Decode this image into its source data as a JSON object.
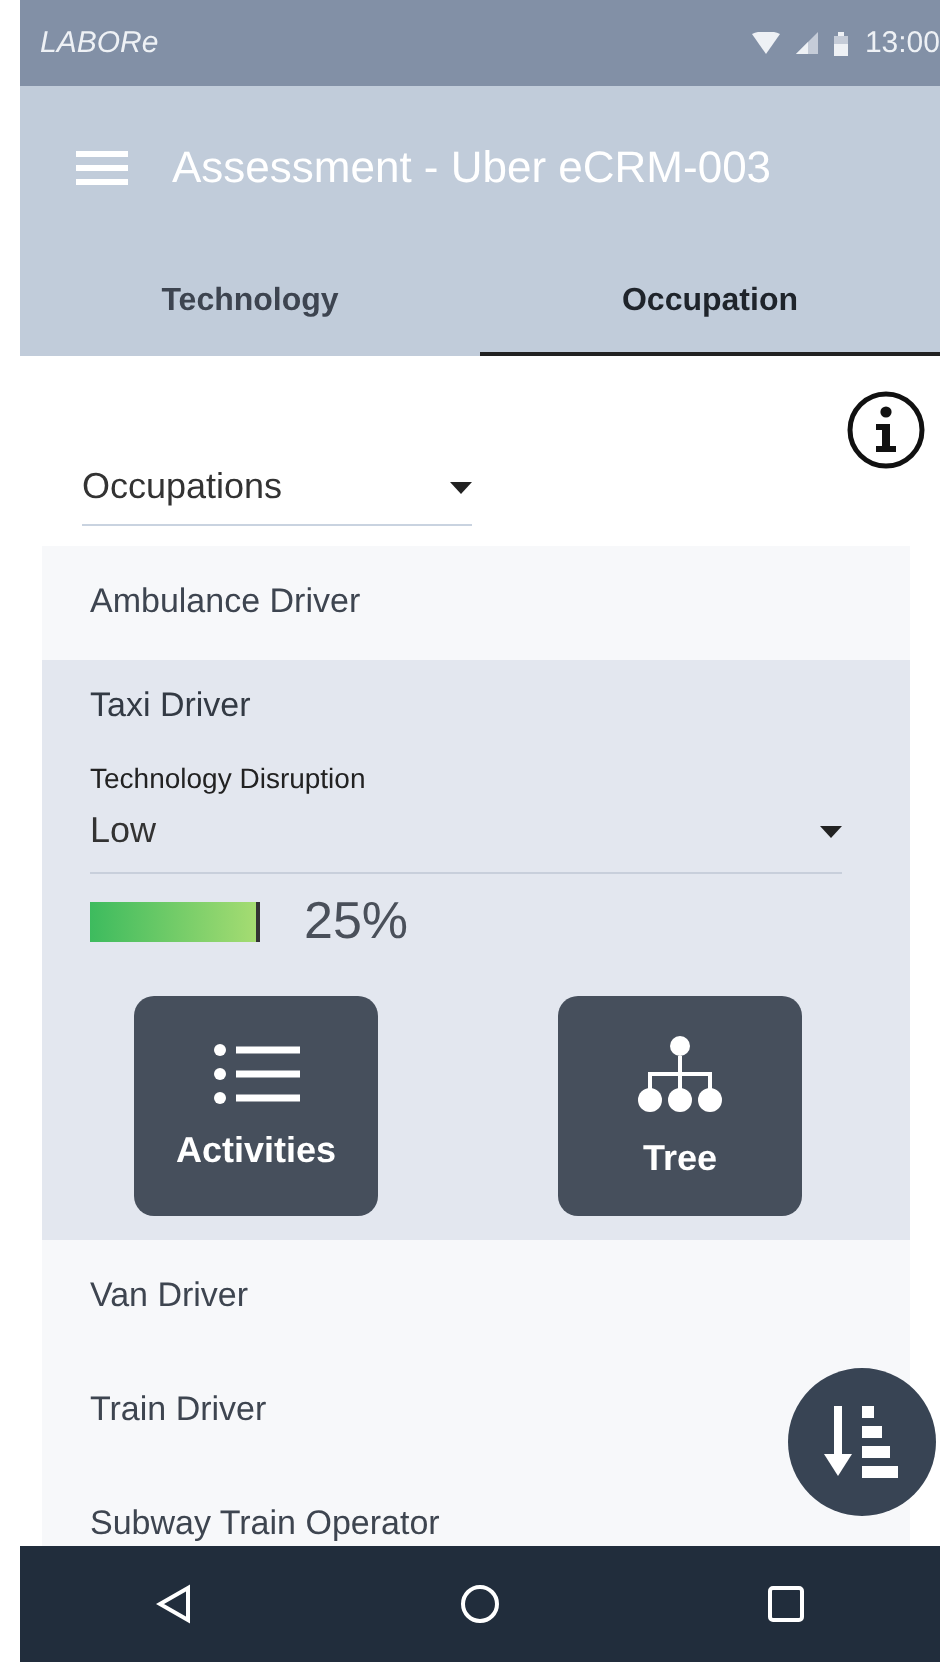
{
  "status_bar": {
    "app_name": "LABORe",
    "time": "13:00"
  },
  "app_bar": {
    "title": "Assessment - Uber eCRM-003"
  },
  "tabs": [
    {
      "label": "Technology",
      "selected": false
    },
    {
      "label": "Occupation",
      "selected": true
    }
  ],
  "filter": {
    "value": "Occupations"
  },
  "occupations": [
    {
      "name": "Ambulance Driver",
      "expanded": false
    },
    {
      "name": "Taxi Driver",
      "expanded": true,
      "disruption_label": "Technology Disruption",
      "disruption_value": "Low",
      "percent": "25%",
      "actions": [
        {
          "label": "Activities",
          "kind": "list"
        },
        {
          "label": "Tree",
          "kind": "tree"
        }
      ]
    },
    {
      "name": "Van Driver",
      "expanded": false
    },
    {
      "name": "Train Driver",
      "expanded": false
    },
    {
      "name": "Subway Train Operator",
      "expanded": false
    }
  ],
  "navigation": [
    {
      "kind": "back"
    },
    {
      "kind": "home"
    },
    {
      "kind": "recents"
    }
  ]
}
